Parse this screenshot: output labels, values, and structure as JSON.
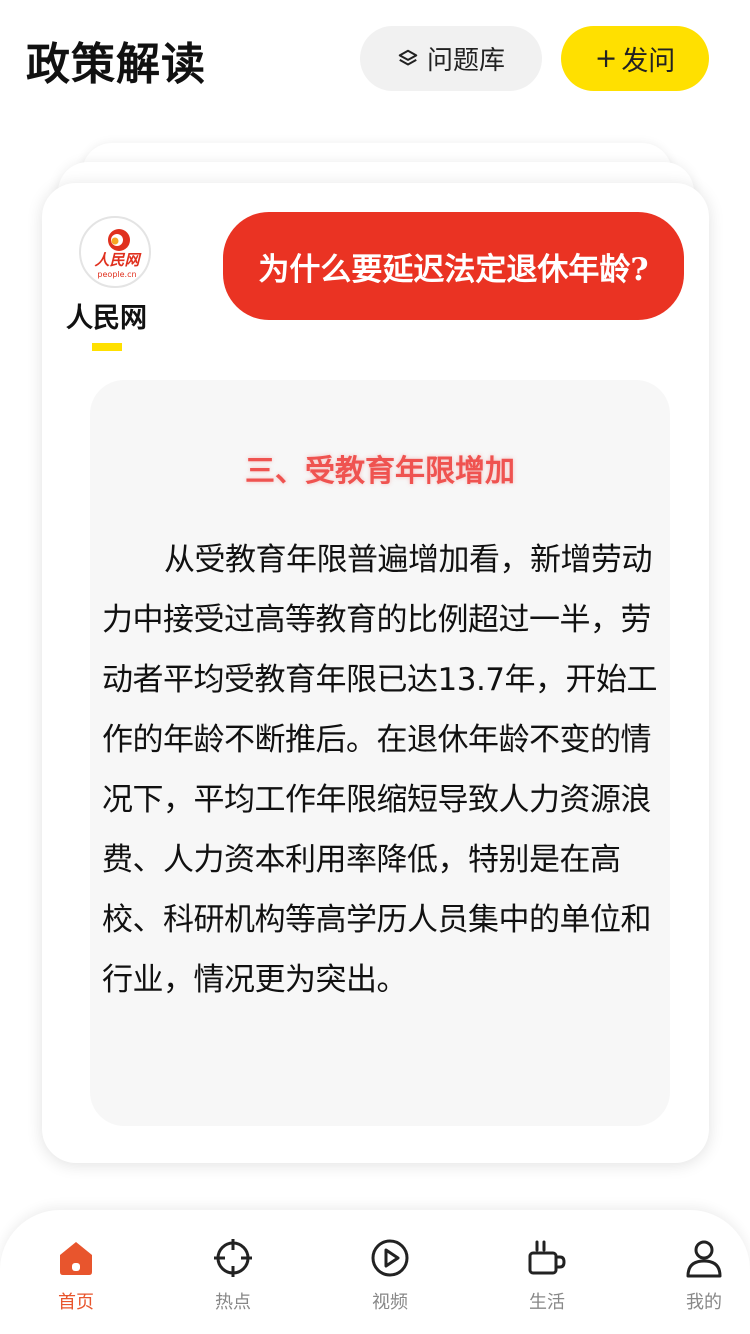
{
  "header": {
    "title": "政策解读",
    "library_label": "问题库",
    "ask_label": "发问",
    "ask_prefix": "+"
  },
  "card": {
    "publisher": {
      "name": "人民网",
      "logo_text": "人民网",
      "logo_subtext": "people.cn"
    },
    "question": "为什么要延迟法定退休年龄?",
    "section_title": "三、受教育年限增加",
    "body": "从受教育年限普遍增加看，新增劳动力中接受过高等教育的比例超过一半，劳动者平均受教育年限已达13.7年，开始工作的年龄不断推后。在退休年龄不变的情况下，平均工作年限缩短导致人力资源浪费、人力资本利用率降低，特别是在高校、科研机构等高学历人员集中的单位和行业，情况更为突出。"
  },
  "tabbar": {
    "tabs": [
      {
        "label": "首页",
        "icon": "home-icon",
        "active": true
      },
      {
        "label": "热点",
        "icon": "crosshair-icon",
        "active": false
      },
      {
        "label": "视频",
        "icon": "play-icon",
        "active": false
      },
      {
        "label": "生活",
        "icon": "coffee-cup-icon",
        "active": false
      },
      {
        "label": "我的",
        "icon": "user-icon",
        "active": false
      }
    ]
  },
  "colors": {
    "accent_yellow": "#ffe000",
    "question_red": "#ea3323",
    "section_red": "#ef5350",
    "tab_active": "#e8552d",
    "tab_inactive": "#888888"
  }
}
